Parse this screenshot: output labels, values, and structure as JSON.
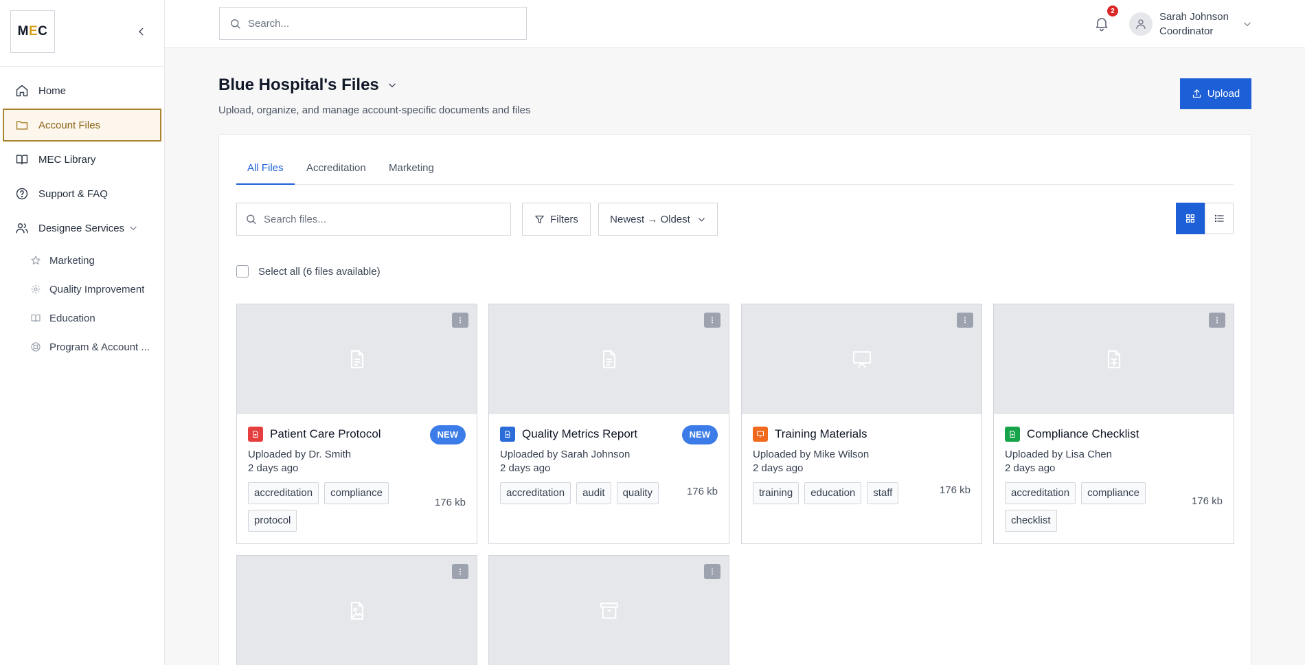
{
  "brand": {
    "logo_m": "M",
    "logo_e": "E",
    "logo_c": "C"
  },
  "sidebar": {
    "items": [
      {
        "label": "Home",
        "icon": "home-icon"
      },
      {
        "label": "Account Files",
        "icon": "folder-icon",
        "active": true
      },
      {
        "label": "MEC Library",
        "icon": "book-icon"
      },
      {
        "label": "Support & FAQ",
        "icon": "help-circle-icon"
      },
      {
        "label": "Designee Services",
        "icon": "users-icon",
        "expanded": true
      }
    ],
    "sub_items": [
      {
        "label": "Marketing",
        "icon": "star-icon"
      },
      {
        "label": "Quality Improvement",
        "icon": "gear-icon"
      },
      {
        "label": "Education",
        "icon": "open-book-icon"
      },
      {
        "label": "Program & Account ...",
        "icon": "lifebuoy-icon"
      }
    ]
  },
  "topbar": {
    "search_placeholder": "Search...",
    "notification_count": "2",
    "user_name": "Sarah Johnson",
    "user_role": "Coordinator"
  },
  "header": {
    "title": "Blue Hospital's Files",
    "subtitle": "Upload, organize, and manage account-specific documents and files",
    "upload_label": "Upload"
  },
  "tabs": [
    {
      "label": "All Files",
      "active": true
    },
    {
      "label": "Accreditation"
    },
    {
      "label": "Marketing"
    }
  ],
  "toolbar": {
    "search_placeholder": "Search files...",
    "filters_label": "Filters",
    "sort_label": "Newest → Oldest",
    "select_all_label": "Select all (6 files available)"
  },
  "colors": {
    "primary": "#1d5fd6",
    "accent": "#a7832f",
    "new_badge": "#3b7ce8",
    "pdf": "#e53e3e",
    "doc": "#2b6cd9",
    "ppt": "#f06a1d",
    "sheet": "#16a34a"
  },
  "files": [
    {
      "title": "Patient Care Protocol",
      "type_icon": "pdf-file-icon",
      "uploader": "Uploaded by Dr. Smith",
      "time": "2 days ago",
      "tags": [
        "accreditation",
        "compliance",
        "protocol"
      ],
      "size": "176 kb",
      "badge": "NEW"
    },
    {
      "title": "Quality Metrics Report",
      "type_icon": "doc-file-icon",
      "uploader": "Uploaded by Sarah Johnson",
      "time": "2 days ago",
      "tags": [
        "accreditation",
        "audit",
        "quality"
      ],
      "size": "176 kb",
      "badge": "NEW"
    },
    {
      "title": "Training Materials",
      "type_icon": "presentation-file-icon",
      "uploader": "Uploaded by Mike Wilson",
      "time": "2 days ago",
      "tags": [
        "training",
        "education",
        "staff"
      ],
      "size": "176 kb"
    },
    {
      "title": "Compliance Checklist",
      "type_icon": "spreadsheet-file-icon",
      "uploader": "Uploaded by Lisa Chen",
      "time": "2 days ago",
      "tags": [
        "accreditation",
        "compliance",
        "checklist"
      ],
      "size": "176 kb"
    }
  ]
}
